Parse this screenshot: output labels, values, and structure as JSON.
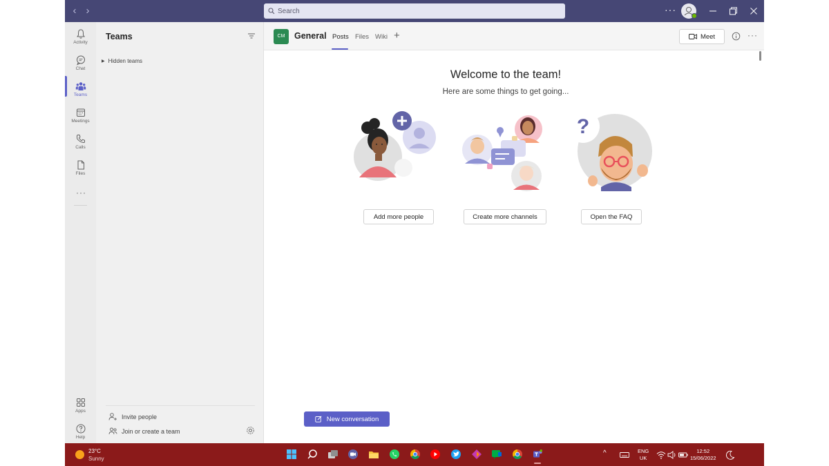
{
  "titlebar": {
    "search_placeholder": "Search",
    "colors": {
      "bar": "#464775",
      "search_bg": "#e4e5f2"
    }
  },
  "rail": {
    "items": [
      {
        "label": "Activity",
        "icon": "bell-icon"
      },
      {
        "label": "Chat",
        "icon": "chat-icon"
      },
      {
        "label": "Teams",
        "icon": "teams-icon",
        "active": true
      },
      {
        "label": "Meetings",
        "icon": "calendar-icon"
      },
      {
        "label": "Calls",
        "icon": "phone-icon"
      },
      {
        "label": "Files",
        "icon": "file-icon"
      }
    ],
    "bottom_items": [
      {
        "label": "Apps",
        "icon": "apps-icon"
      },
      {
        "label": "Help",
        "icon": "help-icon"
      }
    ],
    "more_label": "···"
  },
  "teams_panel": {
    "title": "Teams",
    "hidden_teams": "Hidden teams",
    "invite_people": "Invite people",
    "join_or_create": "Join or create a team"
  },
  "channel": {
    "team_initials": "CM",
    "name": "General",
    "tabs": [
      {
        "label": "Posts",
        "active": true
      },
      {
        "label": "Files"
      },
      {
        "label": "Wiki"
      }
    ],
    "add_tab": "+",
    "meet_label": "Meet",
    "more_label": "···"
  },
  "welcome": {
    "title": "Welcome to the team!",
    "subtitle": "Here are some things to get going...",
    "actions": [
      {
        "label": "Add more people"
      },
      {
        "label": "Create more channels"
      },
      {
        "label": "Open the FAQ"
      }
    ],
    "faq_mark": "?"
  },
  "compose": {
    "new_conversation": "New conversation"
  },
  "taskbar": {
    "weather_temp": "23°C",
    "weather_condition": "Sunny",
    "language_line1": "ENG",
    "language_line2": "UK",
    "time": "12:52",
    "date": "15/06/2022",
    "colors": {
      "bar": "#8b1a1a",
      "accent": "#5b5fc7"
    }
  }
}
